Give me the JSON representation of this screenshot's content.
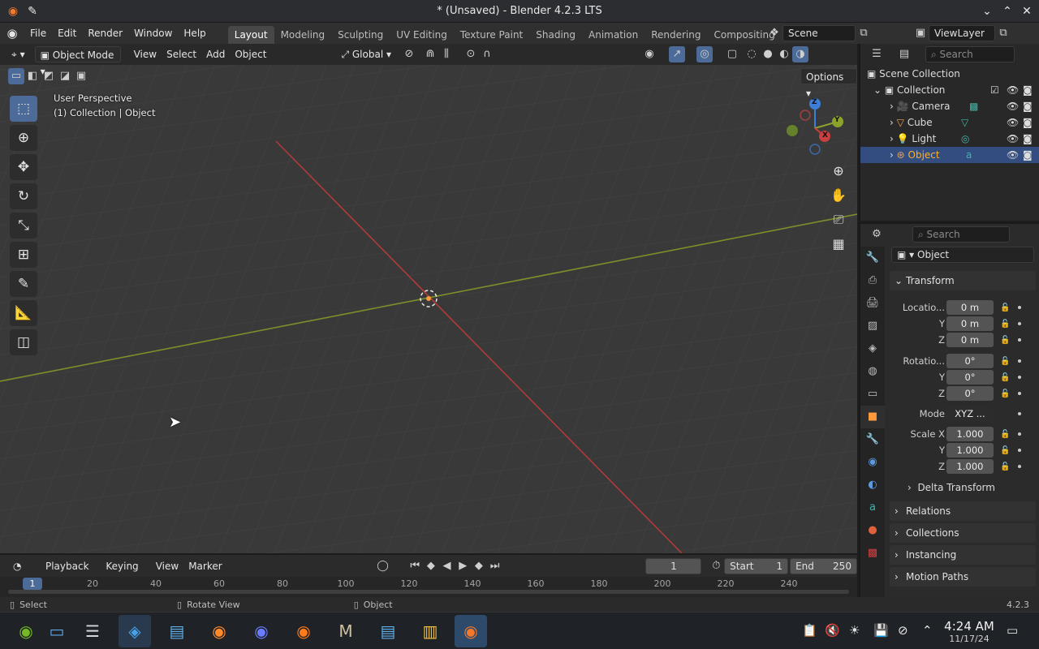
{
  "window": {
    "title": "* (Unsaved) - Blender 4.2.3 LTS"
  },
  "menu": {
    "items": [
      "File",
      "Edit",
      "Render",
      "Window",
      "Help"
    ]
  },
  "workspaces": [
    "Layout",
    "Modeling",
    "Sculpting",
    "UV Editing",
    "Texture Paint",
    "Shading",
    "Animation",
    "Rendering",
    "Compositing"
  ],
  "active_workspace": "Layout",
  "scene": {
    "name": "Scene",
    "view_layer": "ViewLayer"
  },
  "viewport": {
    "mode": "Object Mode",
    "menus": [
      "View",
      "Select",
      "Add",
      "Object"
    ],
    "transform_orientation": "Global",
    "options_label": "Options",
    "overlay_line1": "User Perspective",
    "overlay_line2": "(1) Collection | Object",
    "axes": {
      "x": "X",
      "y": "Y",
      "z": "Z"
    }
  },
  "timeline": {
    "menus": [
      "Playback",
      "Keying",
      "View",
      "Marker"
    ],
    "current_frame": "1",
    "start_label": "Start",
    "start_value": "1",
    "end_label": "End",
    "end_value": "250",
    "current_marker": "1",
    "ticks": [
      "20",
      "40",
      "60",
      "80",
      "100",
      "120",
      "140",
      "160",
      "180",
      "200",
      "220",
      "240"
    ]
  },
  "status": {
    "select": "Select",
    "rotate": "Rotate View",
    "object": "Object",
    "version": "4.2.3"
  },
  "outliner": {
    "search_placeholder": "Search",
    "root": "Scene Collection",
    "collection": "Collection",
    "items": [
      {
        "name": "Camera"
      },
      {
        "name": "Cube"
      },
      {
        "name": "Light"
      },
      {
        "name": "Object"
      }
    ]
  },
  "properties": {
    "search_placeholder": "Search",
    "object_name": "Object",
    "transform_header": "Transform",
    "location_label": "Locatio...",
    "location": [
      "0 m",
      "0 m",
      "0 m"
    ],
    "rotation_label": "Rotatio...",
    "rotation": [
      "0°",
      "0°",
      "0°"
    ],
    "mode_label": "Mode",
    "mode_value": "XYZ ...",
    "scale_label": "Scale X",
    "scale": [
      "1.000",
      "1.000",
      "1.000"
    ],
    "y_label": "Y",
    "z_label": "Z",
    "delta_transform": "Delta Transform",
    "panels": [
      "Relations",
      "Collections",
      "Instancing",
      "Motion Paths"
    ]
  },
  "taskbar": {
    "time": "4:24 AM",
    "date": "11/17/24"
  },
  "colors": {
    "accent": "#4c6b99",
    "selected_row": "#334d80",
    "selected_text": "#ffaf29",
    "x_axis": "#c8403f",
    "y_axis": "#8ca32b",
    "z_axis": "#3d7fd6"
  }
}
